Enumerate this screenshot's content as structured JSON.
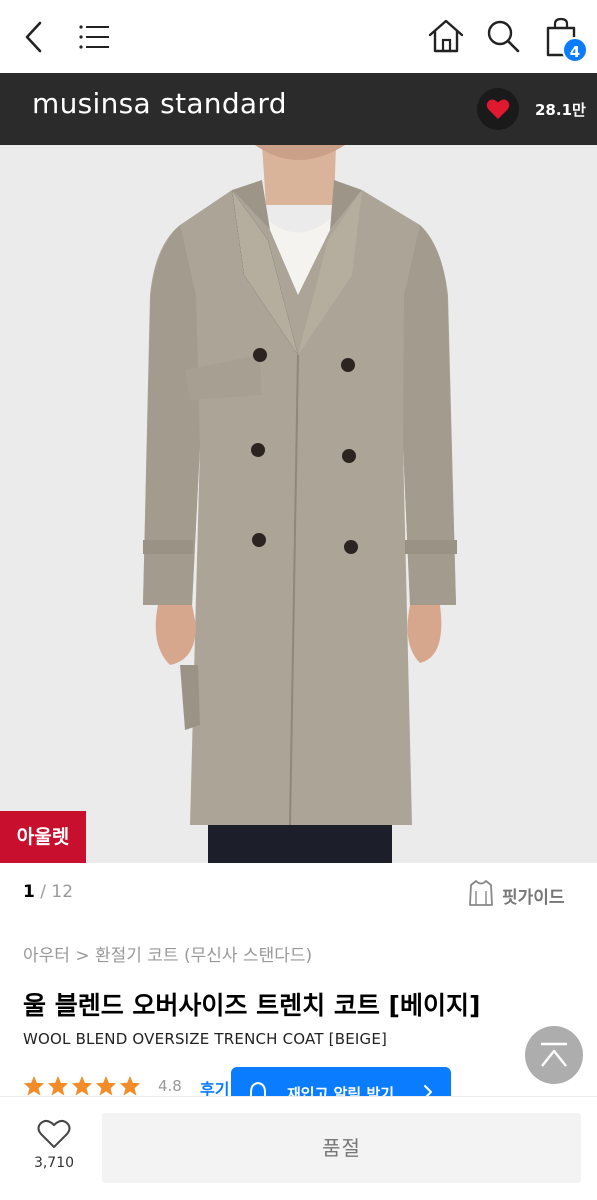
{
  "topnav": {
    "cart_count": "4"
  },
  "brand": {
    "name": "musinsa standard",
    "like_count": "28.1만"
  },
  "hero": {
    "outlet_label": "아울렛"
  },
  "pager": {
    "current": "1",
    "separator": " / ",
    "total": "12"
  },
  "fit_guide": {
    "label": "핏가이드"
  },
  "breadcrumb": "아우터 > 환절기 코트 (무신사 스탠다드)",
  "product": {
    "title_ko": "울 블렌드 오버사이즈 트렌치 코트 [베이지]",
    "title_en": "WOOL BLEND OVERSIZE TRENCH COAT [BEIGE]",
    "rating": "4.8",
    "review_label": "후기",
    "stars": 5
  },
  "restock": {
    "label": "재입고 알림 받기"
  },
  "bottom": {
    "wish_count": "3,710",
    "soldout_label": "품절"
  },
  "colors": {
    "accent": "#0a7cff",
    "outlet": "#c8102e",
    "brandbar": "#2b2b2b",
    "star": "#f28c28"
  }
}
